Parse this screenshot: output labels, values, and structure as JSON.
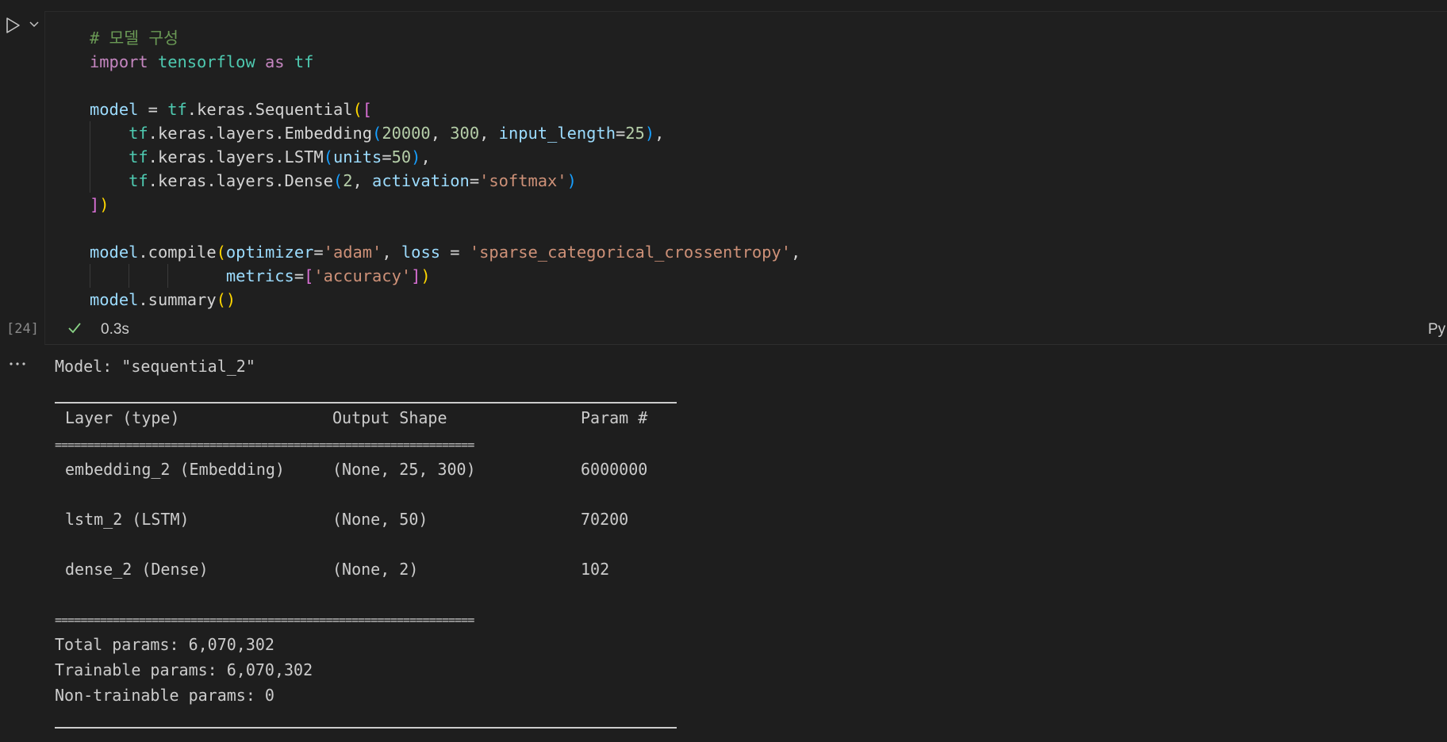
{
  "cell": {
    "code_lines": [
      [
        {
          "t": "# 모델 구성",
          "c": "cmt"
        }
      ],
      [
        {
          "t": "import",
          "c": "kw"
        },
        {
          "t": " "
        },
        {
          "t": "tensorflow",
          "c": "mod"
        },
        {
          "t": " "
        },
        {
          "t": "as",
          "c": "kw"
        },
        {
          "t": " "
        },
        {
          "t": "tf",
          "c": "mod"
        }
      ],
      [],
      [
        {
          "t": "model",
          "c": "var"
        },
        {
          "t": " = "
        },
        {
          "t": "tf",
          "c": "mod"
        },
        {
          "t": ".keras."
        },
        {
          "t": "Sequential",
          "c": "plain"
        },
        {
          "t": "(",
          "c": "p1"
        },
        {
          "t": "[",
          "c": "p2"
        }
      ],
      [
        {
          "t": "    "
        },
        {
          "t": "tf",
          "c": "mod"
        },
        {
          "t": ".keras.layers.Embedding"
        },
        {
          "t": "(",
          "c": "p3"
        },
        {
          "t": "20000",
          "c": "num"
        },
        {
          "t": ", "
        },
        {
          "t": "300",
          "c": "num"
        },
        {
          "t": ", "
        },
        {
          "t": "input_length",
          "c": "var"
        },
        {
          "t": "="
        },
        {
          "t": "25",
          "c": "num"
        },
        {
          "t": ")",
          "c": "p3"
        },
        {
          "t": ","
        }
      ],
      [
        {
          "t": "    "
        },
        {
          "t": "tf",
          "c": "mod"
        },
        {
          "t": ".keras.layers.LSTM"
        },
        {
          "t": "(",
          "c": "p3"
        },
        {
          "t": "units",
          "c": "var"
        },
        {
          "t": "="
        },
        {
          "t": "50",
          "c": "num"
        },
        {
          "t": ")",
          "c": "p3"
        },
        {
          "t": ","
        }
      ],
      [
        {
          "t": "    "
        },
        {
          "t": "tf",
          "c": "mod"
        },
        {
          "t": ".keras.layers.Dense"
        },
        {
          "t": "(",
          "c": "p3"
        },
        {
          "t": "2",
          "c": "num"
        },
        {
          "t": ", "
        },
        {
          "t": "activation",
          "c": "var"
        },
        {
          "t": "="
        },
        {
          "t": "'softmax'",
          "c": "str"
        },
        {
          "t": ")",
          "c": "p3"
        }
      ],
      [
        {
          "t": "]",
          "c": "p2"
        },
        {
          "t": ")",
          "c": "p1"
        }
      ],
      [],
      [
        {
          "t": "model",
          "c": "var"
        },
        {
          "t": "."
        },
        {
          "t": "compile",
          "c": "plain"
        },
        {
          "t": "(",
          "c": "p1"
        },
        {
          "t": "optimizer",
          "c": "var"
        },
        {
          "t": "="
        },
        {
          "t": "'adam'",
          "c": "str"
        },
        {
          "t": ", "
        },
        {
          "t": "loss",
          "c": "var"
        },
        {
          "t": " = "
        },
        {
          "t": "'sparse_categorical_crossentropy'",
          "c": "str"
        },
        {
          "t": ","
        }
      ],
      [
        {
          "t": "              "
        },
        {
          "t": "metrics",
          "c": "var"
        },
        {
          "t": "="
        },
        {
          "t": "[",
          "c": "p2"
        },
        {
          "t": "'accuracy'",
          "c": "str"
        },
        {
          "t": "]",
          "c": "p2"
        },
        {
          "t": ")",
          "c": "p1"
        }
      ],
      [
        {
          "t": "model",
          "c": "var"
        },
        {
          "t": "."
        },
        {
          "t": "summary",
          "c": "plain"
        },
        {
          "t": "(",
          "c": "p1"
        },
        {
          "t": ")",
          "c": "p1"
        }
      ]
    ],
    "execution_count": "[24]",
    "duration": "0.3s",
    "kernel_label": "Py"
  },
  "output": {
    "model_line": "Model: \"sequential_2\"",
    "header": {
      "layer": "Layer (type)",
      "shape": "Output Shape",
      "params": "Param #"
    },
    "rows": [
      {
        "layer": "embedding_2 (Embedding)",
        "shape": "(None, 25, 300)",
        "params": "6000000"
      },
      {
        "layer": "lstm_2 (LSTM)",
        "shape": "(None, 50)",
        "params": "70200"
      },
      {
        "layer": "dense_2 (Dense)",
        "shape": "(None, 2)",
        "params": "102"
      }
    ],
    "separator": "=================================================================",
    "total": "Total params: 6,070,302",
    "trainable": "Trainable params: 6,070,302",
    "non_trainable": "Non-trainable params: 0"
  },
  "icons": {
    "run": "play-icon",
    "run_menu": "chevron-down-icon",
    "status": "check-icon",
    "output_menu": "ellipsis-icon"
  },
  "colors": {
    "background": "#1e1e1e",
    "success": "#89d185"
  }
}
